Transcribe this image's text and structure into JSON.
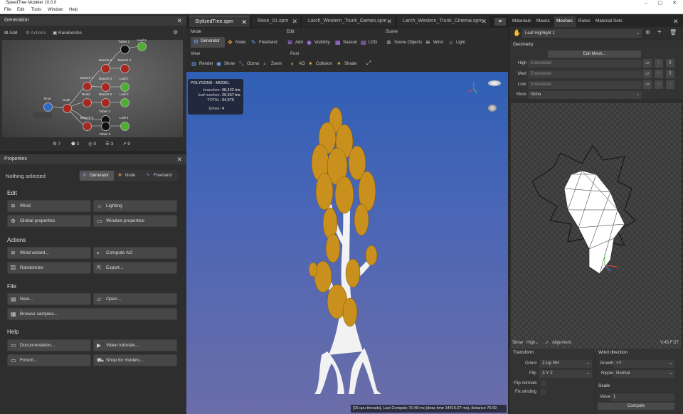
{
  "app": {
    "title": "SpeedTree Modeler 10.0.0"
  },
  "menu": [
    "File",
    "Edit",
    "Tools",
    "Window",
    "Help"
  ],
  "generation": {
    "title": "Generation",
    "add": "Add",
    "actions": "Actions",
    "randomize": "Randomize",
    "nodes": [
      {
        "label": "Root"
      },
      {
        "label": "Trunk"
      },
      {
        "label": "Branch 1"
      },
      {
        "label": "Branch 2"
      },
      {
        "label": "Branch 3"
      },
      {
        "label": "Branch 4"
      },
      {
        "label": "Branch 5"
      },
      {
        "label": "Branch 6"
      },
      {
        "label": "Roots"
      },
      {
        "label": "Tubes 1"
      },
      {
        "label": "Tubes 2"
      },
      {
        "label": "Tubes 3"
      },
      {
        "label": "Leaf 1"
      },
      {
        "label": "Leaf 2"
      },
      {
        "label": "Leaf 3"
      },
      {
        "label": "Leaf 4"
      }
    ],
    "counts": [
      "7",
      "3",
      "0",
      "3",
      "9"
    ]
  },
  "properties": {
    "title": "Properties",
    "nothing_selected": "Nothing selected",
    "modes": [
      "Generator",
      "Node",
      "Freehand"
    ],
    "edit_title": "Edit",
    "edit_buttons": [
      "Wind",
      "Lighting",
      "Global properties",
      "Window properties"
    ],
    "actions_title": "Actions",
    "actions_buttons": [
      "Wind wizard...",
      "Compute AO",
      "Randomize",
      "Export..."
    ],
    "file_title": "File",
    "file_buttons": [
      "New...",
      "Open...",
      "Browse samples..."
    ],
    "help_title": "Help",
    "help_buttons": [
      "Documentation...",
      "Video tutorials...",
      "Forum...",
      "Shop for models..."
    ]
  },
  "tabs": [
    "StylizedTree.spm",
    "Rose_01.spm",
    "Larch_Western_Trunk_Games.spm",
    "Larch_Western_Trunk_Cinema.spm"
  ],
  "toolbar": {
    "mode_label": "Mode",
    "mode_buttons": [
      "Generator",
      "Node",
      "Freehand"
    ],
    "edit_label": "Edit",
    "edit_buttons": [
      "Add",
      "Visibility",
      "Season",
      "LOD"
    ],
    "scene_label": "Scene",
    "scene_buttons": [
      "Scene Objects",
      "Wind",
      "Light"
    ],
    "view_label": "View",
    "view_buttons": [
      "Render",
      "Show",
      "Gizmo",
      "Zoom"
    ],
    "post_label": "Post",
    "post_buttons": [
      "AO",
      "Collision",
      "Shade"
    ]
  },
  "stats": {
    "title": "POLYGONS - MODEL",
    "rows": [
      {
        "k": "branches:",
        "v": "68,422 tris"
      },
      {
        "k": "leaf meshes:",
        "v": "26,557 tris"
      },
      {
        "k": "TOTAL:",
        "v": "94,979"
      },
      {
        "k": "bones:",
        "v": "4"
      }
    ]
  },
  "status": "[16 cpu threads], Last Compute 70.48 ms (draw time 14416.07 ms), distance 75.59",
  "right": {
    "tabs": [
      "Materials",
      "Masks",
      "Meshes",
      "Rules",
      "Material Sets"
    ],
    "active_tab": "Meshes",
    "mesh_name": "Leaf Highlight 1",
    "geometry_title": "Geometry",
    "edit_mesh": "Edit Mesh...",
    "lods": [
      {
        "label": "High",
        "value": "Embedded"
      },
      {
        "label": "Med",
        "value": "Embedded"
      },
      {
        "label": "Low",
        "value": "Embedded"
      }
    ],
    "more_label": "More",
    "more_value": "None",
    "show_label": "Show",
    "show_value": "High",
    "alignment_label": "Alignment",
    "coords": "V:45  F:57",
    "transform_title": "Transform",
    "orient_label": "Orient",
    "orient_value": "Z-Up RH",
    "flip_label": "Flip",
    "flip_value": "X Y Z",
    "flip_normals": "Flip normals",
    "fix_winding": "Fix winding",
    "wind_title": "Wind direction",
    "growth_label": "Growth",
    "growth_value": "+Y",
    "ripple_label": "Ripple",
    "ripple_value": "Normal",
    "scale_title": "Scale",
    "value_label": "Value",
    "value_value": "1",
    "compute": "Compute"
  },
  "colors": {
    "accent": "#4a8cff",
    "panel": "#2e2e2e",
    "viewport_top": "#2f5fb5",
    "viewport_bottom": "#6b6da8"
  }
}
